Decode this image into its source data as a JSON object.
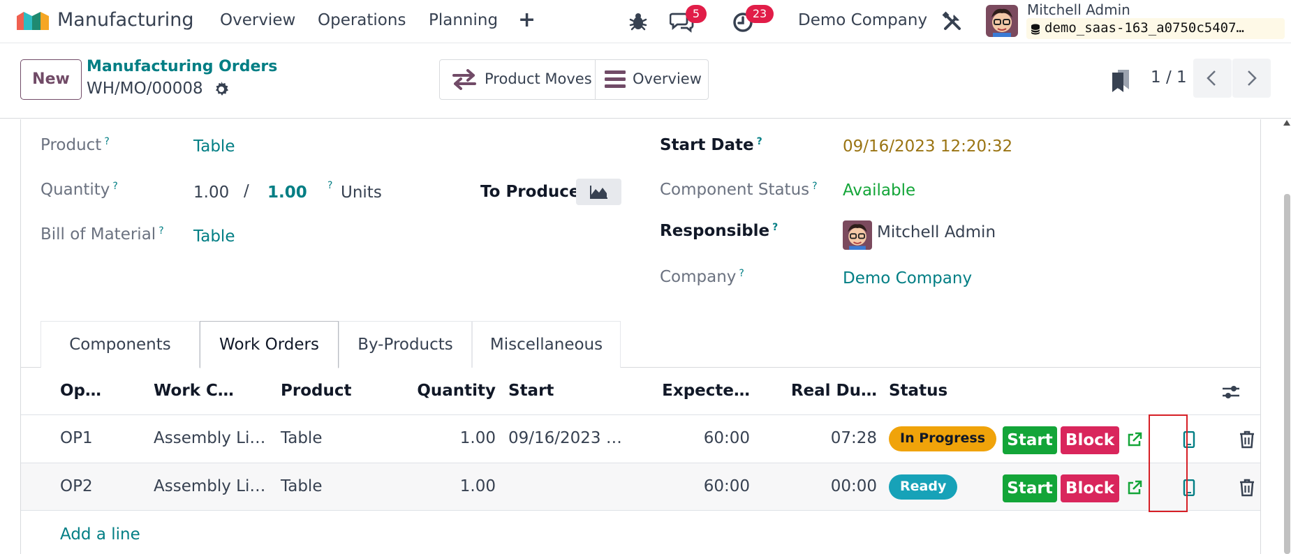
{
  "navbar": {
    "app_name": "Manufacturing",
    "menus": [
      "Overview",
      "Operations",
      "Planning"
    ],
    "plus": "+",
    "chat_count": "5",
    "activity_count": "23",
    "company": "Demo Company",
    "user_name": "Mitchell Admin",
    "db_name": "demo_saas-163_a0750c5407…"
  },
  "control_panel": {
    "new_label": "New",
    "breadcrumb_parent": "Manufacturing Orders",
    "record_name": "WH/MO/00008",
    "smart_buttons": {
      "product_moves": "Product Moves",
      "overview": "Overview"
    },
    "pager": "1 / 1"
  },
  "form": {
    "product_label": "Product",
    "product_value": "Table",
    "quantity_label": "Quantity",
    "quantity_produced": "1.00",
    "quantity_separator": "/",
    "quantity_target": "1.00",
    "quantity_unit": "Units",
    "to_produce_label": "To Produce",
    "bom_label": "Bill of Material",
    "bom_value": "Table",
    "start_date_label": "Start Date",
    "start_date_value": "09/16/2023 12:20:32",
    "component_status_label": "Component Status",
    "component_status_value": "Available",
    "responsible_label": "Responsible",
    "responsible_value": "Mitchell Admin",
    "company_label": "Company",
    "company_value": "Demo Company",
    "help_mark": "?"
  },
  "tabs": [
    "Components",
    "Work Orders",
    "By-Products",
    "Miscellaneous"
  ],
  "active_tab": "Work Orders",
  "table": {
    "headers": [
      "Op…",
      "Work C…",
      "Product",
      "Quantity",
      "Start",
      "Expecte…",
      "Real Du…",
      "Status"
    ],
    "rows": [
      {
        "operation": "OP1",
        "work_center": "Assembly Li…",
        "product": "Table",
        "quantity": "1.00",
        "start": "09/16/2023 …",
        "expected": "60:00",
        "real": "07:28",
        "status": "In Progress",
        "status_color": "#f0a30a"
      },
      {
        "operation": "OP2",
        "work_center": "Assembly Li…",
        "product": "Table",
        "quantity": "1.00",
        "start": "",
        "expected": "60:00",
        "real": "00:00",
        "status": "Ready",
        "status_color": "#17a2b8"
      }
    ],
    "start_label": "Start",
    "block_label": "Block",
    "add_line": "Add a line"
  },
  "colors": {
    "brand": "#714b67",
    "link": "#017e84",
    "start_date": "#9a7413",
    "available": "#13a538",
    "start_button": "#13a538",
    "block_button": "#d9265c",
    "badge": "#e11d48",
    "highlight": "#d61f26"
  }
}
